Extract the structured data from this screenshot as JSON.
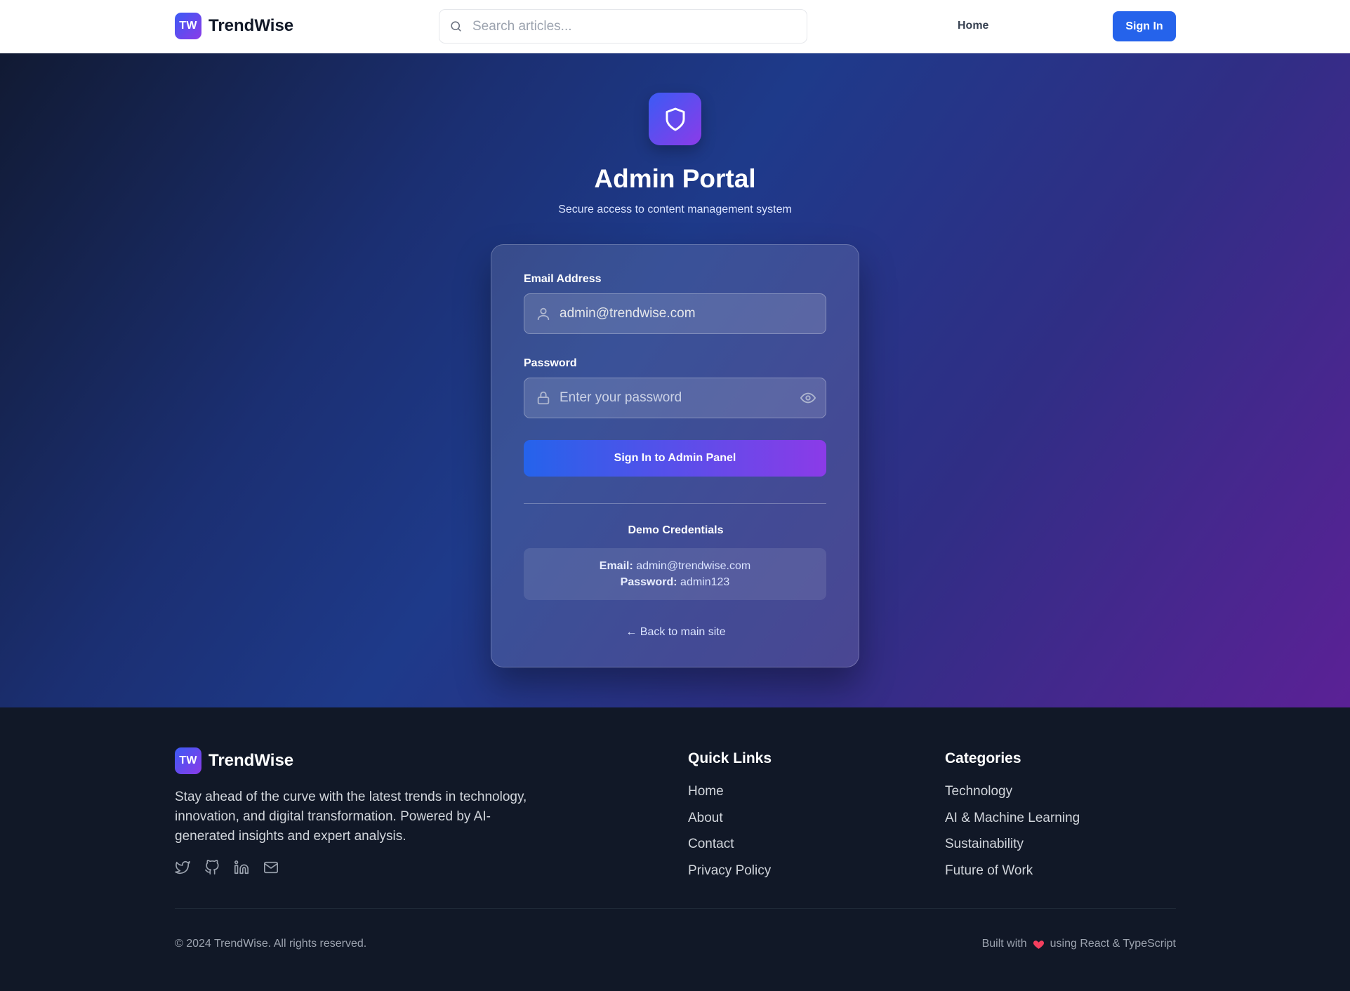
{
  "header": {
    "logo_badge": "TW",
    "logo_text": "TrendWise",
    "search_placeholder": "Search articles...",
    "nav_home": "Home",
    "sign_in": "Sign In"
  },
  "hero": {
    "icon": "shield-icon",
    "title": "Admin Portal",
    "subtitle": "Secure access to content management system"
  },
  "form": {
    "email_label": "Email Address",
    "email_value": "admin@trendwise.com",
    "password_label": "Password",
    "password_placeholder": "Enter your password",
    "submit_label": "Sign In to Admin Panel",
    "demo_title": "Demo Credentials",
    "demo_email_label": "Email:",
    "demo_email_value": "admin@trendwise.com",
    "demo_password_label": "Password:",
    "demo_password_value": "admin123",
    "back_link": "← Back to main site"
  },
  "footer": {
    "logo_badge": "TW",
    "logo_text": "TrendWise",
    "description": "Stay ahead of the curve with the latest trends in technology, innovation, and digital transformation. Powered by AI-generated insights and expert analysis.",
    "socials": [
      "twitter-icon",
      "github-icon",
      "linkedin-icon",
      "mail-icon"
    ],
    "quick_links_title": "Quick Links",
    "quick_links": [
      "Home",
      "About",
      "Contact",
      "Privacy Policy"
    ],
    "categories_title": "Categories",
    "categories": [
      "Technology",
      "AI & Machine Learning",
      "Sustainability",
      "Future of Work"
    ],
    "copyright": "© 2024 TrendWise. All rights reserved.",
    "built_prefix": "Built with",
    "built_suffix": "using React & TypeScript"
  },
  "colors": {
    "accent": "#2563eb",
    "gradient_start": "#3b5bf5",
    "gradient_end": "#8b3be8",
    "footer_bg": "#111827",
    "heart": "#f43f5e"
  }
}
